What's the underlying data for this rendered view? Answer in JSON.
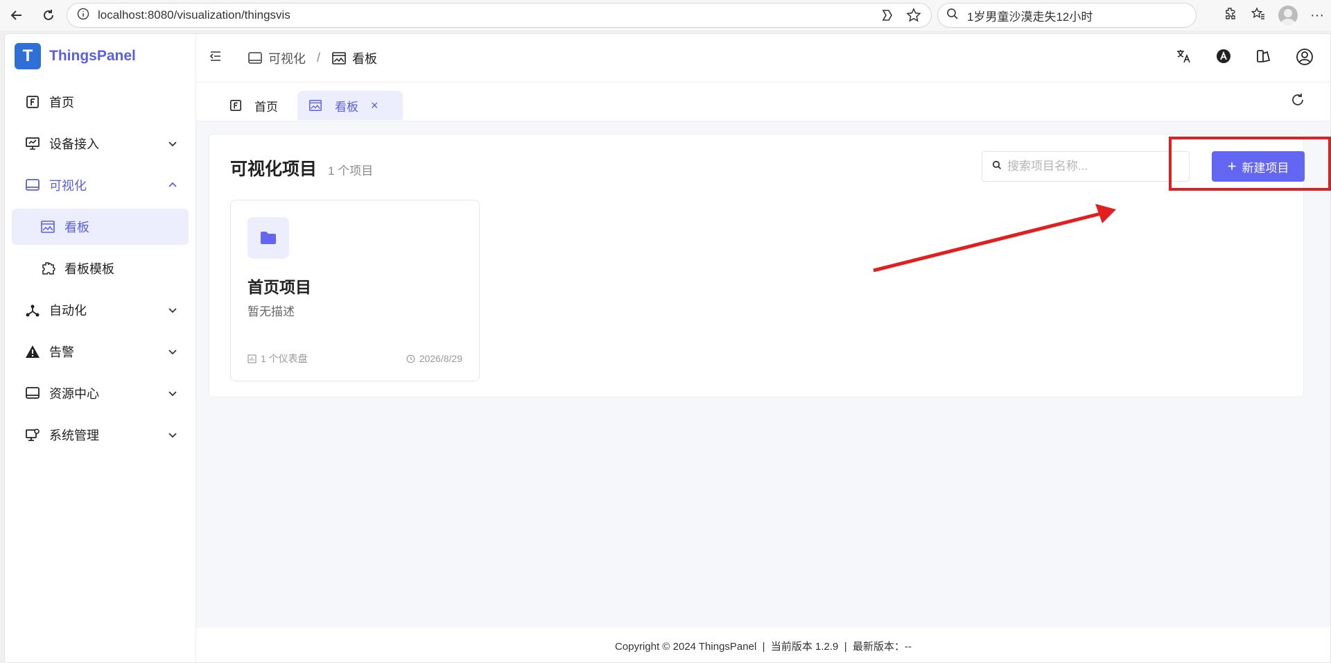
{
  "browser": {
    "url": "localhost:8080/visualization/thingsvis",
    "search_query": "1岁男童沙漠走失12小时"
  },
  "app": {
    "brand": "ThingsPanel",
    "logo_letter": "T"
  },
  "sidebar": {
    "items": [
      {
        "label": "首页"
      },
      {
        "label": "设备接入"
      },
      {
        "label": "可视化"
      },
      {
        "label": "看板"
      },
      {
        "label": "看板模板"
      },
      {
        "label": "自动化"
      },
      {
        "label": "告警"
      },
      {
        "label": "资源中心"
      },
      {
        "label": "系统管理"
      }
    ]
  },
  "breadcrumb": {
    "parent": "可视化",
    "separator": "/",
    "current": "看板"
  },
  "tabs": {
    "home": "首页",
    "board": "看板",
    "close": "×"
  },
  "panel": {
    "title": "可视化项目",
    "count": "1 个项目",
    "search_placeholder": "搜索项目名称...",
    "new_button": "新建项目",
    "plus": "+"
  },
  "card": {
    "title": "首页项目",
    "description": "暂无描述",
    "dashboards": "1 个仪表盘",
    "date": "2026/8/29"
  },
  "footer": {
    "text": "Copyright © 2024 ThingsPanel  |  当前版本 1.2.9  |  最新版本：--"
  },
  "colors": {
    "accent": "#6366f1",
    "annotation": "#e02020"
  }
}
